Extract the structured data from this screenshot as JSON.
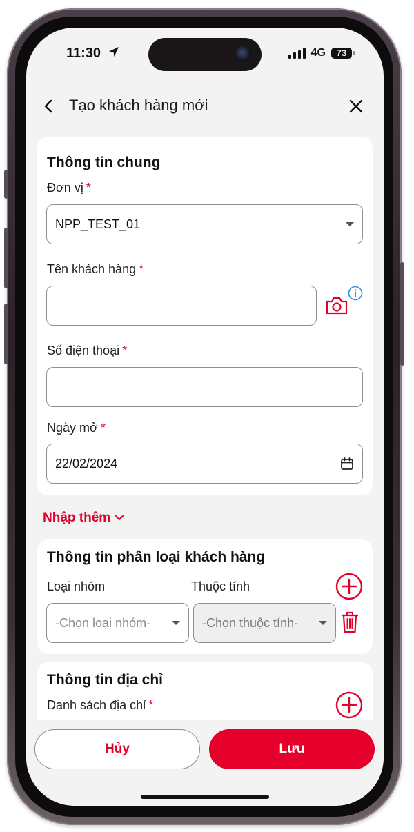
{
  "status": {
    "time": "11:30",
    "network": "4G",
    "battery": "73"
  },
  "header": {
    "title": "Tạo khách hàng mới"
  },
  "general": {
    "title": "Thông tin chung",
    "unit": {
      "label": "Đơn vị",
      "required": "*",
      "value": "NPP_TEST_01"
    },
    "customer_name": {
      "label": "Tên khách hàng",
      "required": "*",
      "value": ""
    },
    "phone": {
      "label": "Số điện thoại",
      "required": "*",
      "value": ""
    },
    "open_date": {
      "label": "Ngày mở",
      "required": "*",
      "value": "22/02/2024"
    }
  },
  "more_link": "Nhập thêm",
  "classification": {
    "title": "Thông tin phân loại khách hàng",
    "group_label": "Loại nhóm",
    "attribute_label": "Thuộc tính",
    "group_placeholder": "-Chọn loại nhóm-",
    "attribute_placeholder": "-Chọn thuộc tính-"
  },
  "address": {
    "title": "Thông tin địa chỉ",
    "list_label": "Danh sách địa chỉ",
    "required": "*"
  },
  "actions": {
    "cancel": "Hủy",
    "save": "Lưu"
  },
  "colors": {
    "accent": "#e5002b",
    "info": "#2f8fe8",
    "background": "#f3f3f4"
  }
}
